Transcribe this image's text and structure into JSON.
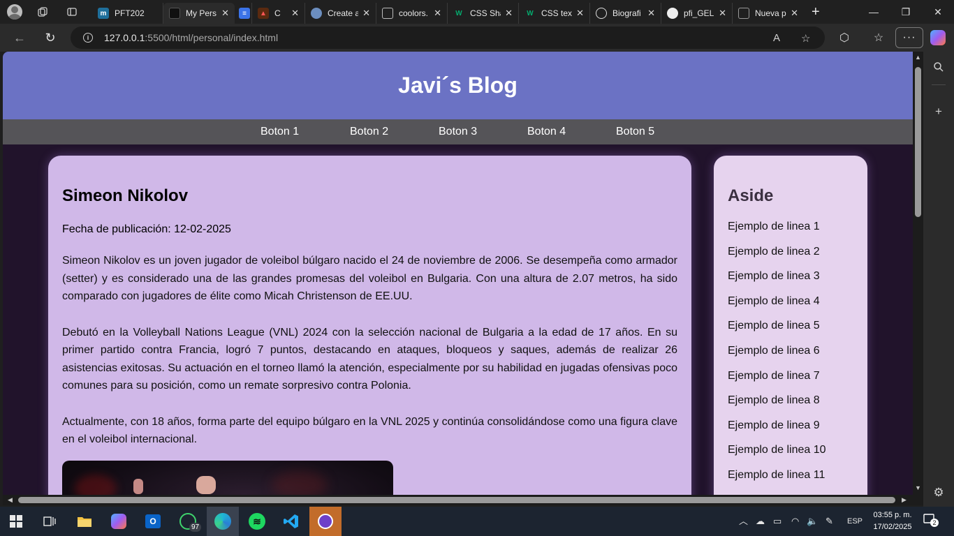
{
  "browser": {
    "tabs": [
      {
        "title": "PFT202",
        "favicon": "moodle-icon",
        "color": "#1f6f9b"
      },
      {
        "title": "My Pers",
        "favicon": "page-icon",
        "color": "#3a3a3a",
        "active": true
      },
      {
        "title": "",
        "favicon": "docs-icon",
        "color": "#3b73e8"
      },
      {
        "title": "C",
        "favicon": "game-icon",
        "color": "#c44"
      },
      {
        "title": "Create a",
        "favicon": "chrome-icon",
        "color": "#6c8ebf"
      },
      {
        "title": "coolors.",
        "favicon": "file-icon",
        "color": "#777"
      },
      {
        "title": "CSS Sha",
        "favicon": "w3schools-icon",
        "color": "#04aa6d"
      },
      {
        "title": "CSS text",
        "favicon": "w3schools-icon",
        "color": "#04aa6d"
      },
      {
        "title": "Biografi",
        "favicon": "chatgpt-icon",
        "color": "#ddd"
      },
      {
        "title": "pfi_GEL",
        "favicon": "github-icon",
        "color": "#ddd"
      },
      {
        "title": "Nueva p",
        "favicon": "newtab-icon",
        "color": "#888"
      }
    ],
    "url_host": "127.0.0.1",
    "url_path": ":5500/html/personal/index.html"
  },
  "site": {
    "title": "Javi´s Blog",
    "nav": [
      "Boton 1",
      "Boton 2",
      "Boton 3",
      "Boton 4",
      "Boton 5"
    ]
  },
  "article": {
    "heading": "Simeon Nikolov",
    "date": "Fecha de publicación: 12-02-2025",
    "paragraphs": [
      "Simeon Nikolov es un joven jugador de voleibol búlgaro nacido el 24 de noviembre de 2006. Se desempeña como armador (setter) y es considerado una de las grandes promesas del voleibol en Bulgaria. Con una altura de 2.07 metros, ha sido comparado con jugadores de élite como Micah Christenson de EE.UU.",
      "Debutó en la Volleyball Nations League (VNL) 2024 con la selección nacional de Bulgaria a la edad de 17 años. En su primer partido contra Francia, logró 7 puntos, destacando en ataques, bloqueos y saques, además de realizar 26 asistencias exitosas. Su actuación en el torneo llamó la atención, especialmente por su habilidad en jugadas ofensivas poco comunes para su posición, como un remate sorpresivo contra Polonia.",
      "Actualmente, con 18 años, forma parte del equipo búlgaro en la VNL 2025 y continúa consolidándose como una figura clave en el voleibol internacional."
    ]
  },
  "aside": {
    "heading": "Aside",
    "lines": [
      "Ejemplo de linea 1",
      "Ejemplo de linea 2",
      "Ejemplo de linea 3",
      "Ejemplo de linea 4",
      "Ejemplo de linea 5",
      "Ejemplo de linea 6",
      "Ejemplo de linea 7",
      "Ejemplo de linea 8",
      "Ejemplo de linea 9",
      "Ejemplo de linea 10",
      "Ejemplo de linea 11"
    ]
  },
  "taskbar": {
    "whatsapp_badge": "97",
    "language": "ESP",
    "time": "03:55 p. m.",
    "date": "17/02/2025",
    "notifications": "2"
  }
}
